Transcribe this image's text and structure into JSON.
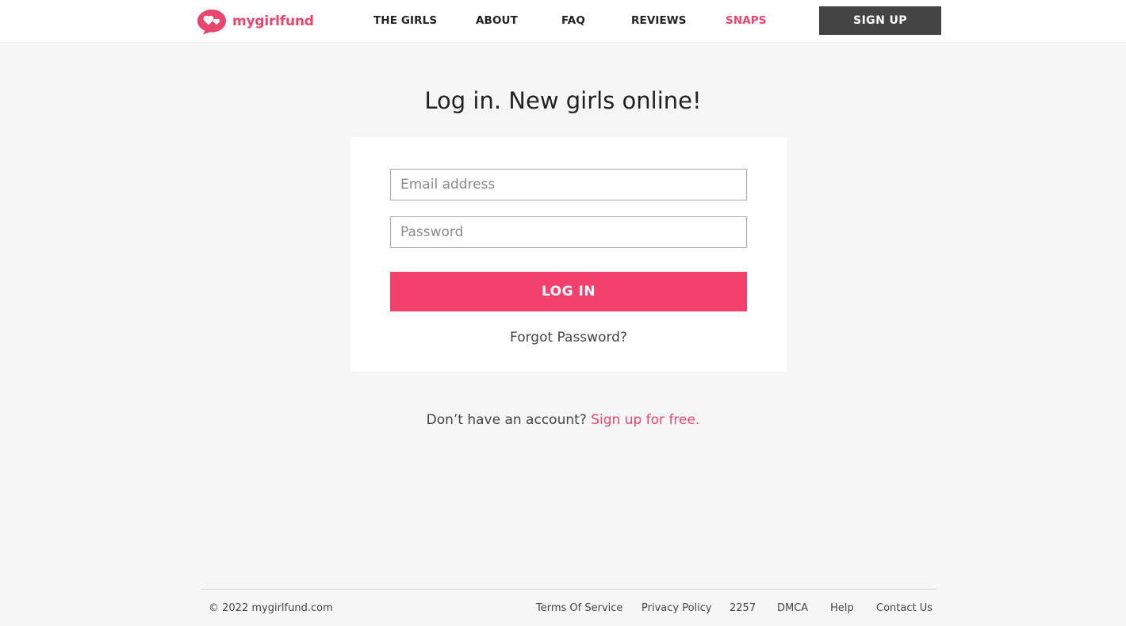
{
  "brand": {
    "name": "mygirlfund",
    "color": "#e8466d"
  },
  "nav": {
    "items": [
      {
        "label": "THE GIRLS"
      },
      {
        "label": "ABOUT"
      },
      {
        "label": "FAQ"
      },
      {
        "label": "REVIEWS"
      },
      {
        "label": "SNAPS",
        "active": true
      }
    ],
    "signup_label": "SIGN UP"
  },
  "login": {
    "title": "Log in. New girls online!",
    "email_placeholder": "Email address",
    "email_value": "",
    "password_placeholder": "Password",
    "password_value": "",
    "button_label": "LOG IN",
    "forgot_label": "Forgot Password?",
    "button_color": "#f2406c"
  },
  "signup_prompt": {
    "text": "Don’t have an account? ",
    "link": "Sign up for free."
  },
  "footer": {
    "copyright": "© 2022 mygirlfund.com",
    "links": [
      {
        "label": "Terms Of Service"
      },
      {
        "label": "Privacy Policy"
      },
      {
        "label": "2257"
      },
      {
        "label": "DMCA"
      },
      {
        "label": "Help"
      },
      {
        "label": "Contact Us"
      }
    ]
  }
}
